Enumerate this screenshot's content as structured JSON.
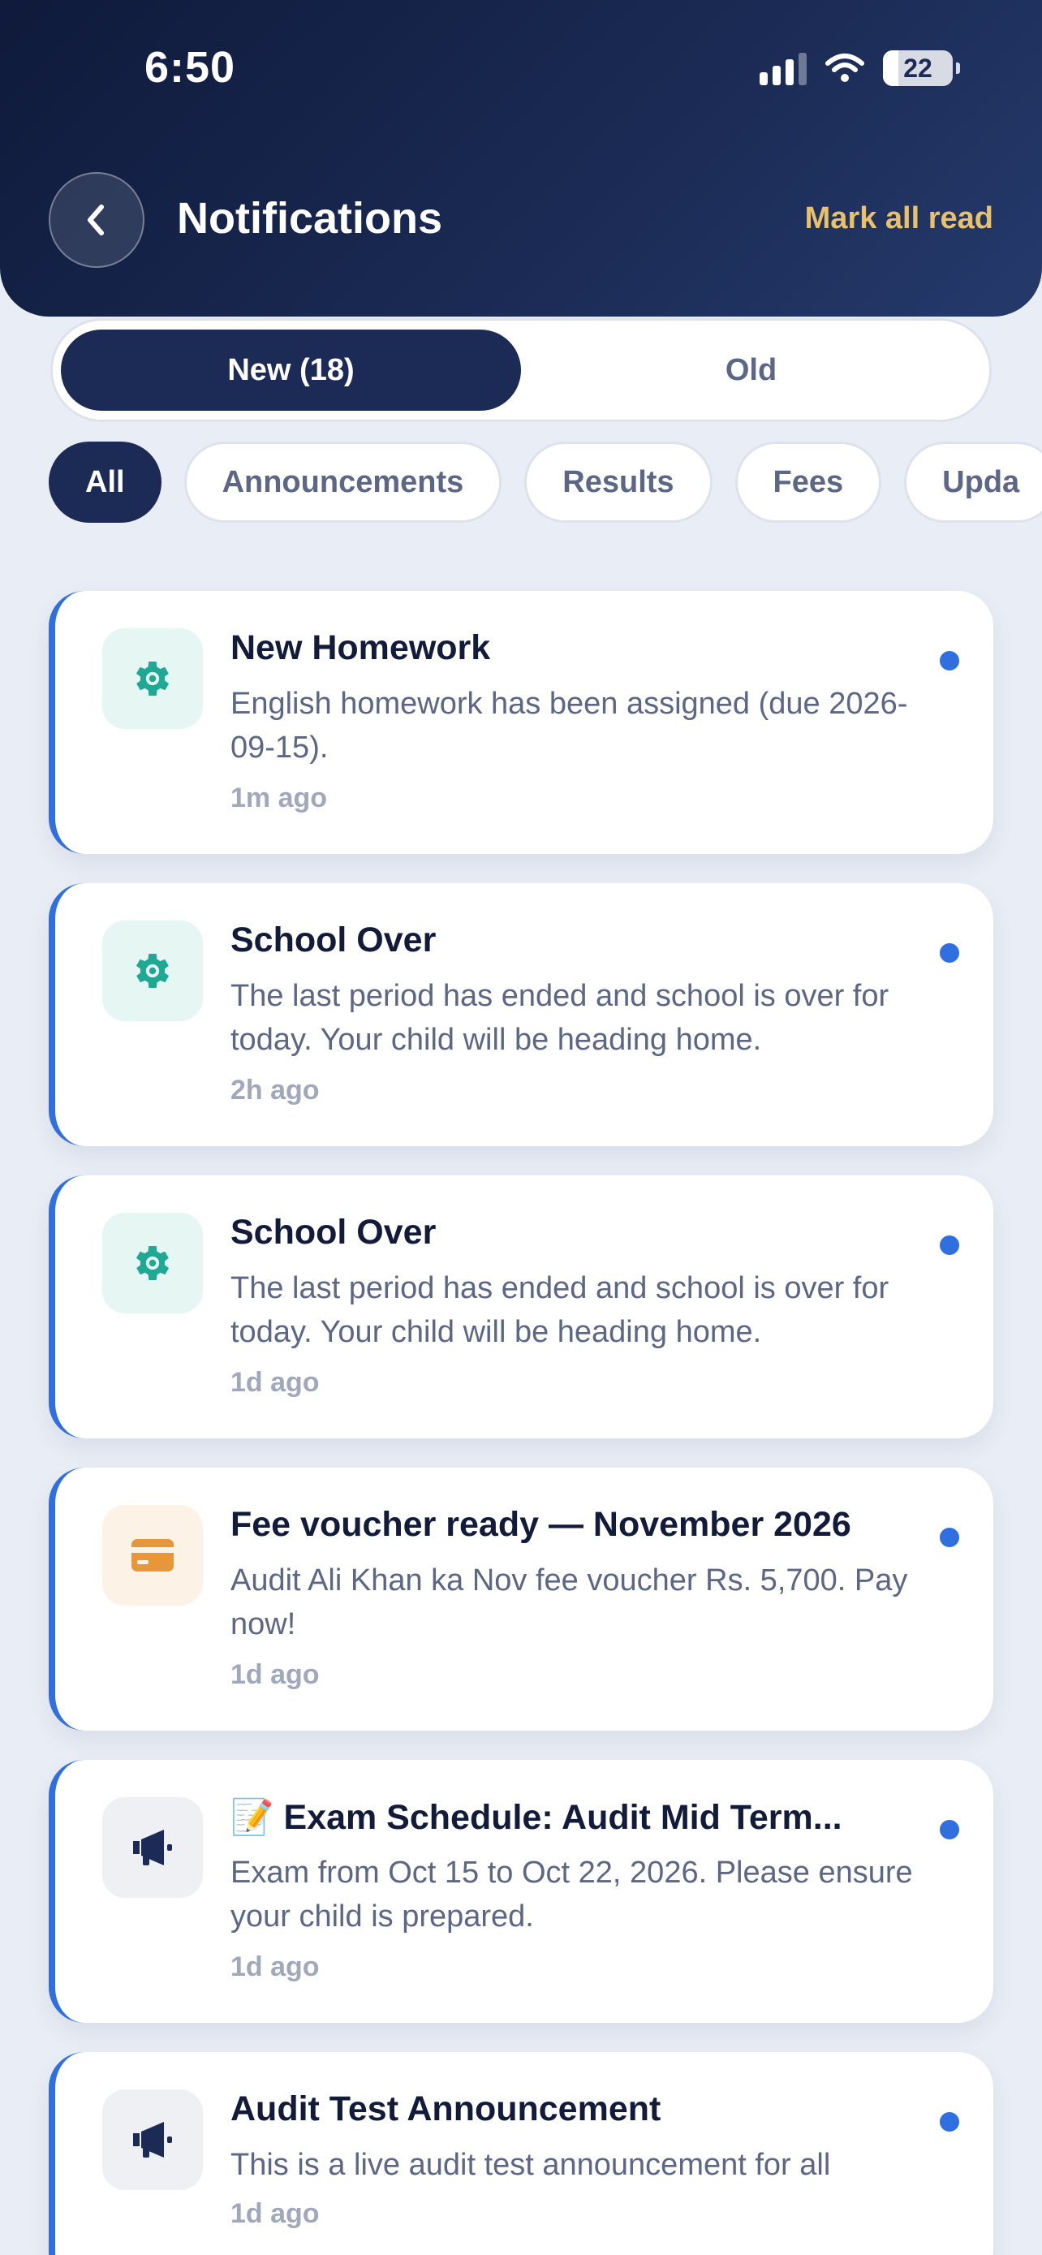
{
  "status_bar": {
    "time": "6:50",
    "battery": "22",
    "battery_level": 0.22
  },
  "header": {
    "title": "Notifications",
    "mark_all_read": "Mark all read"
  },
  "tabs": [
    {
      "label": "New (18)",
      "active": true
    },
    {
      "label": "Old",
      "active": false
    }
  ],
  "filters": [
    {
      "label": "All",
      "active": true
    },
    {
      "label": "Announcements",
      "active": false
    },
    {
      "label": "Results",
      "active": false
    },
    {
      "label": "Fees",
      "active": false
    },
    {
      "label": "Upda",
      "active": false
    }
  ],
  "colors": {
    "header_bg": "#1b2b55",
    "accent_gold": "#e8c16a",
    "unread_blue": "#2f6fe0",
    "gear_green": "#1fa894",
    "fee_orange": "#e8963a"
  },
  "notifications": [
    {
      "icon": "gear-icon",
      "title": "New Homework",
      "body": "English homework has been assigned (due 2026-09-15).",
      "time": "1m ago",
      "unread": true
    },
    {
      "icon": "gear-icon",
      "title": "School Over",
      "body": "The last period has ended and school is over for today. Your child will be heading home.",
      "time": "2h ago",
      "unread": true
    },
    {
      "icon": "gear-icon",
      "title": "School Over",
      "body": "The last period has ended and school is over for today. Your child will be heading home.",
      "time": "1d ago",
      "unread": true
    },
    {
      "icon": "credit-card-icon",
      "title": "Fee voucher ready — November 2026",
      "body": "Audit Ali Khan ka Nov fee voucher Rs. 5,700. Pay now!",
      "time": "1d ago",
      "unread": true
    },
    {
      "icon": "megaphone-icon",
      "title": "📝 Exam Schedule: Audit Mid Term...",
      "body": "Exam from Oct 15 to Oct 22, 2026. Please ensure your child is prepared.",
      "time": "1d ago",
      "unread": true
    },
    {
      "icon": "megaphone-icon",
      "title": "Audit Test Announcement",
      "body": "This is a live audit test announcement for all",
      "time": "1d ago",
      "unread": true
    }
  ]
}
